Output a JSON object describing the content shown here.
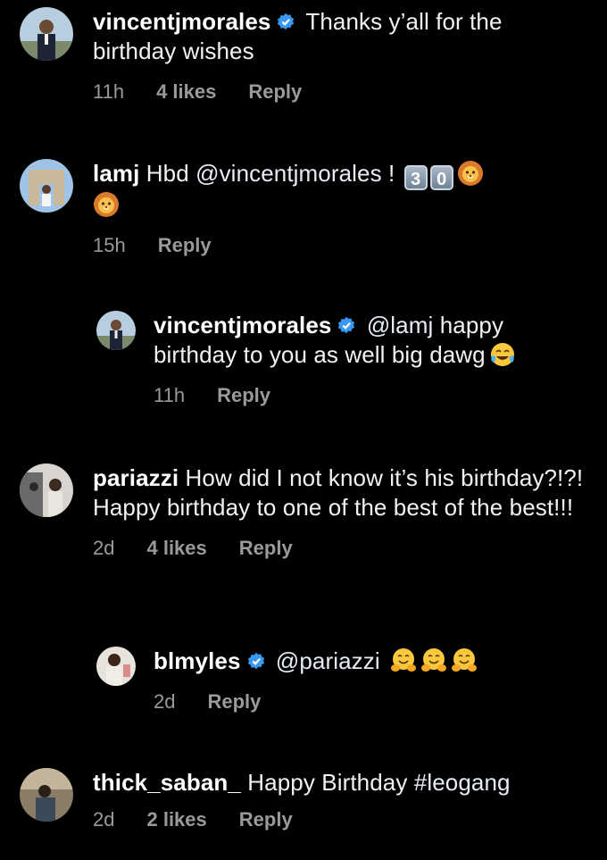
{
  "comments": [
    {
      "username": "vincentjmorales",
      "verified": true,
      "text": "Thanks y’all for the birthday wishes",
      "time": "11h",
      "likes": "4 likes",
      "reply": "Reply"
    },
    {
      "username": "lamj",
      "verified": false,
      "text": "Hbd",
      "mention": "@vincentjmorales",
      "suffix": "!",
      "keycaps": [
        "3",
        "0"
      ],
      "emojis": [
        "lion-face",
        "lion-face"
      ],
      "time": "15h",
      "reply": "Reply"
    },
    {
      "username": "vincentjmorales",
      "verified": true,
      "mention": "@lamj",
      "text": "happy birthday to you as well big dawg",
      "emojis": [
        "face-with-tears-of-joy"
      ],
      "time": "11h",
      "reply": "Reply",
      "is_reply": true
    },
    {
      "username": "pariazzi",
      "verified": false,
      "text": "How did I not know it’s his birthday?!?! Happy birthday to one of the best of the best!!!",
      "time": "2d",
      "likes": "4 likes",
      "reply": "Reply"
    },
    {
      "username": "blmyles",
      "verified": true,
      "mention": "@pariazzi",
      "emojis": [
        "hugging-face",
        "hugging-face",
        "hugging-face"
      ],
      "time": "2d",
      "reply": "Reply",
      "is_reply": true
    },
    {
      "username": "thick_saban_",
      "verified": false,
      "text": "Happy Birthday",
      "hashtag": "#leogang",
      "time": "2d",
      "likes": "2 likes",
      "reply": "Reply"
    }
  ],
  "colors": {
    "background": "#000000",
    "text": "#f2f2f2",
    "meta": "#9a9a9a",
    "verified_badge": "#3897f0"
  }
}
